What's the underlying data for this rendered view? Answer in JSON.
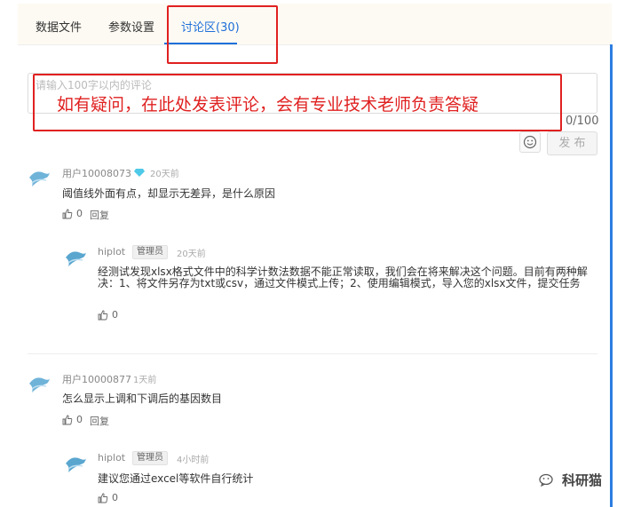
{
  "tabs": [
    {
      "label": "数据文件"
    },
    {
      "label": "参数设置"
    },
    {
      "label": "讨论区(30)"
    }
  ],
  "comment_input": {
    "placeholder": "请输入100字以内的评论",
    "counter": "0/100",
    "overlay_hint": "如有疑问，在此处发表评论，会有专业技术老师负责答疑"
  },
  "post_button": {
    "label": "发 布"
  },
  "comments": [
    {
      "user": "用户10008073",
      "time": "20天前",
      "content": "阈值线外面有点，却显示无差异，是什么原因",
      "likes": "0",
      "reply_label": "回复",
      "reply": {
        "user": "hiplot",
        "badge": "管理员",
        "time": "20天前",
        "content": "经测试发现xlsx格式文件中的科学计数法数据不能正常读取，我们会在将来解决这个问题。目前有两种解决：1、将文件另存为txt或csv，通过文件模式上传；2、使用编辑模式，导入您的xlsx文件，提交任务",
        "likes": "0"
      }
    },
    {
      "user": "用户10000877",
      "time": "1天前",
      "content": "怎么显示上调和下调后的基因数目",
      "likes": "0",
      "reply_label": "回复",
      "reply": {
        "user": "hiplot",
        "badge": "管理员",
        "time": "4小时前",
        "content": "建议您通过excel等软件自行统计",
        "likes": "0"
      }
    }
  ],
  "watermark": {
    "text": "科研猫"
  },
  "colors": {
    "accent": "#1e6fd9",
    "annotation": "#e02020"
  }
}
